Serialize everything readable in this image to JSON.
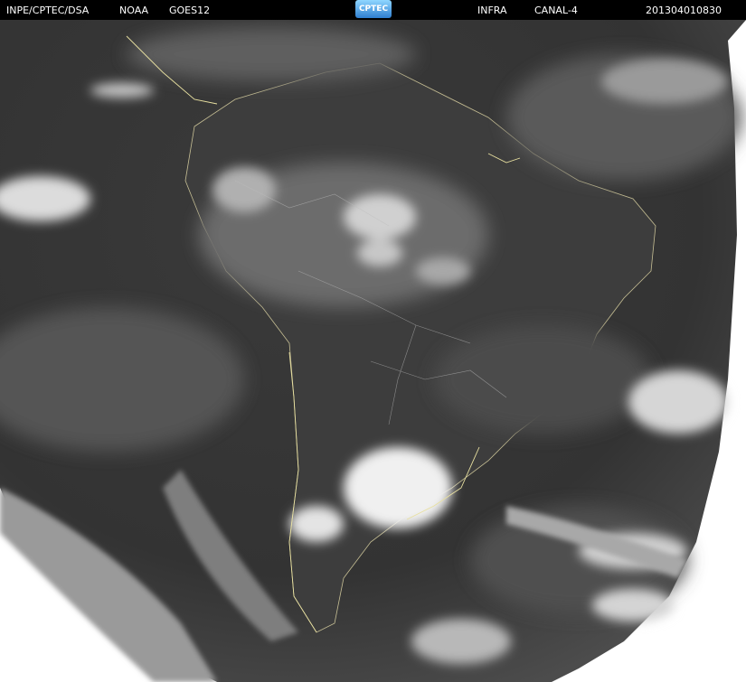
{
  "header": {
    "source": "INPE/CPTEC/DSA",
    "agency": "NOAA",
    "satellite": "GOES12",
    "logo_text": "CPTEC",
    "product": "INFRA",
    "channel": "CANAL-4",
    "timestamp": "201304010830"
  },
  "colors": {
    "header_bg": "#000000",
    "header_text": "#ffffff",
    "page_bg": "#ffffff",
    "earth_dark": "#2d2d2d",
    "cloud": "#ececec",
    "coastline": "#e8e0a0"
  },
  "image": {
    "kind": "infrared satellite image of South America"
  }
}
